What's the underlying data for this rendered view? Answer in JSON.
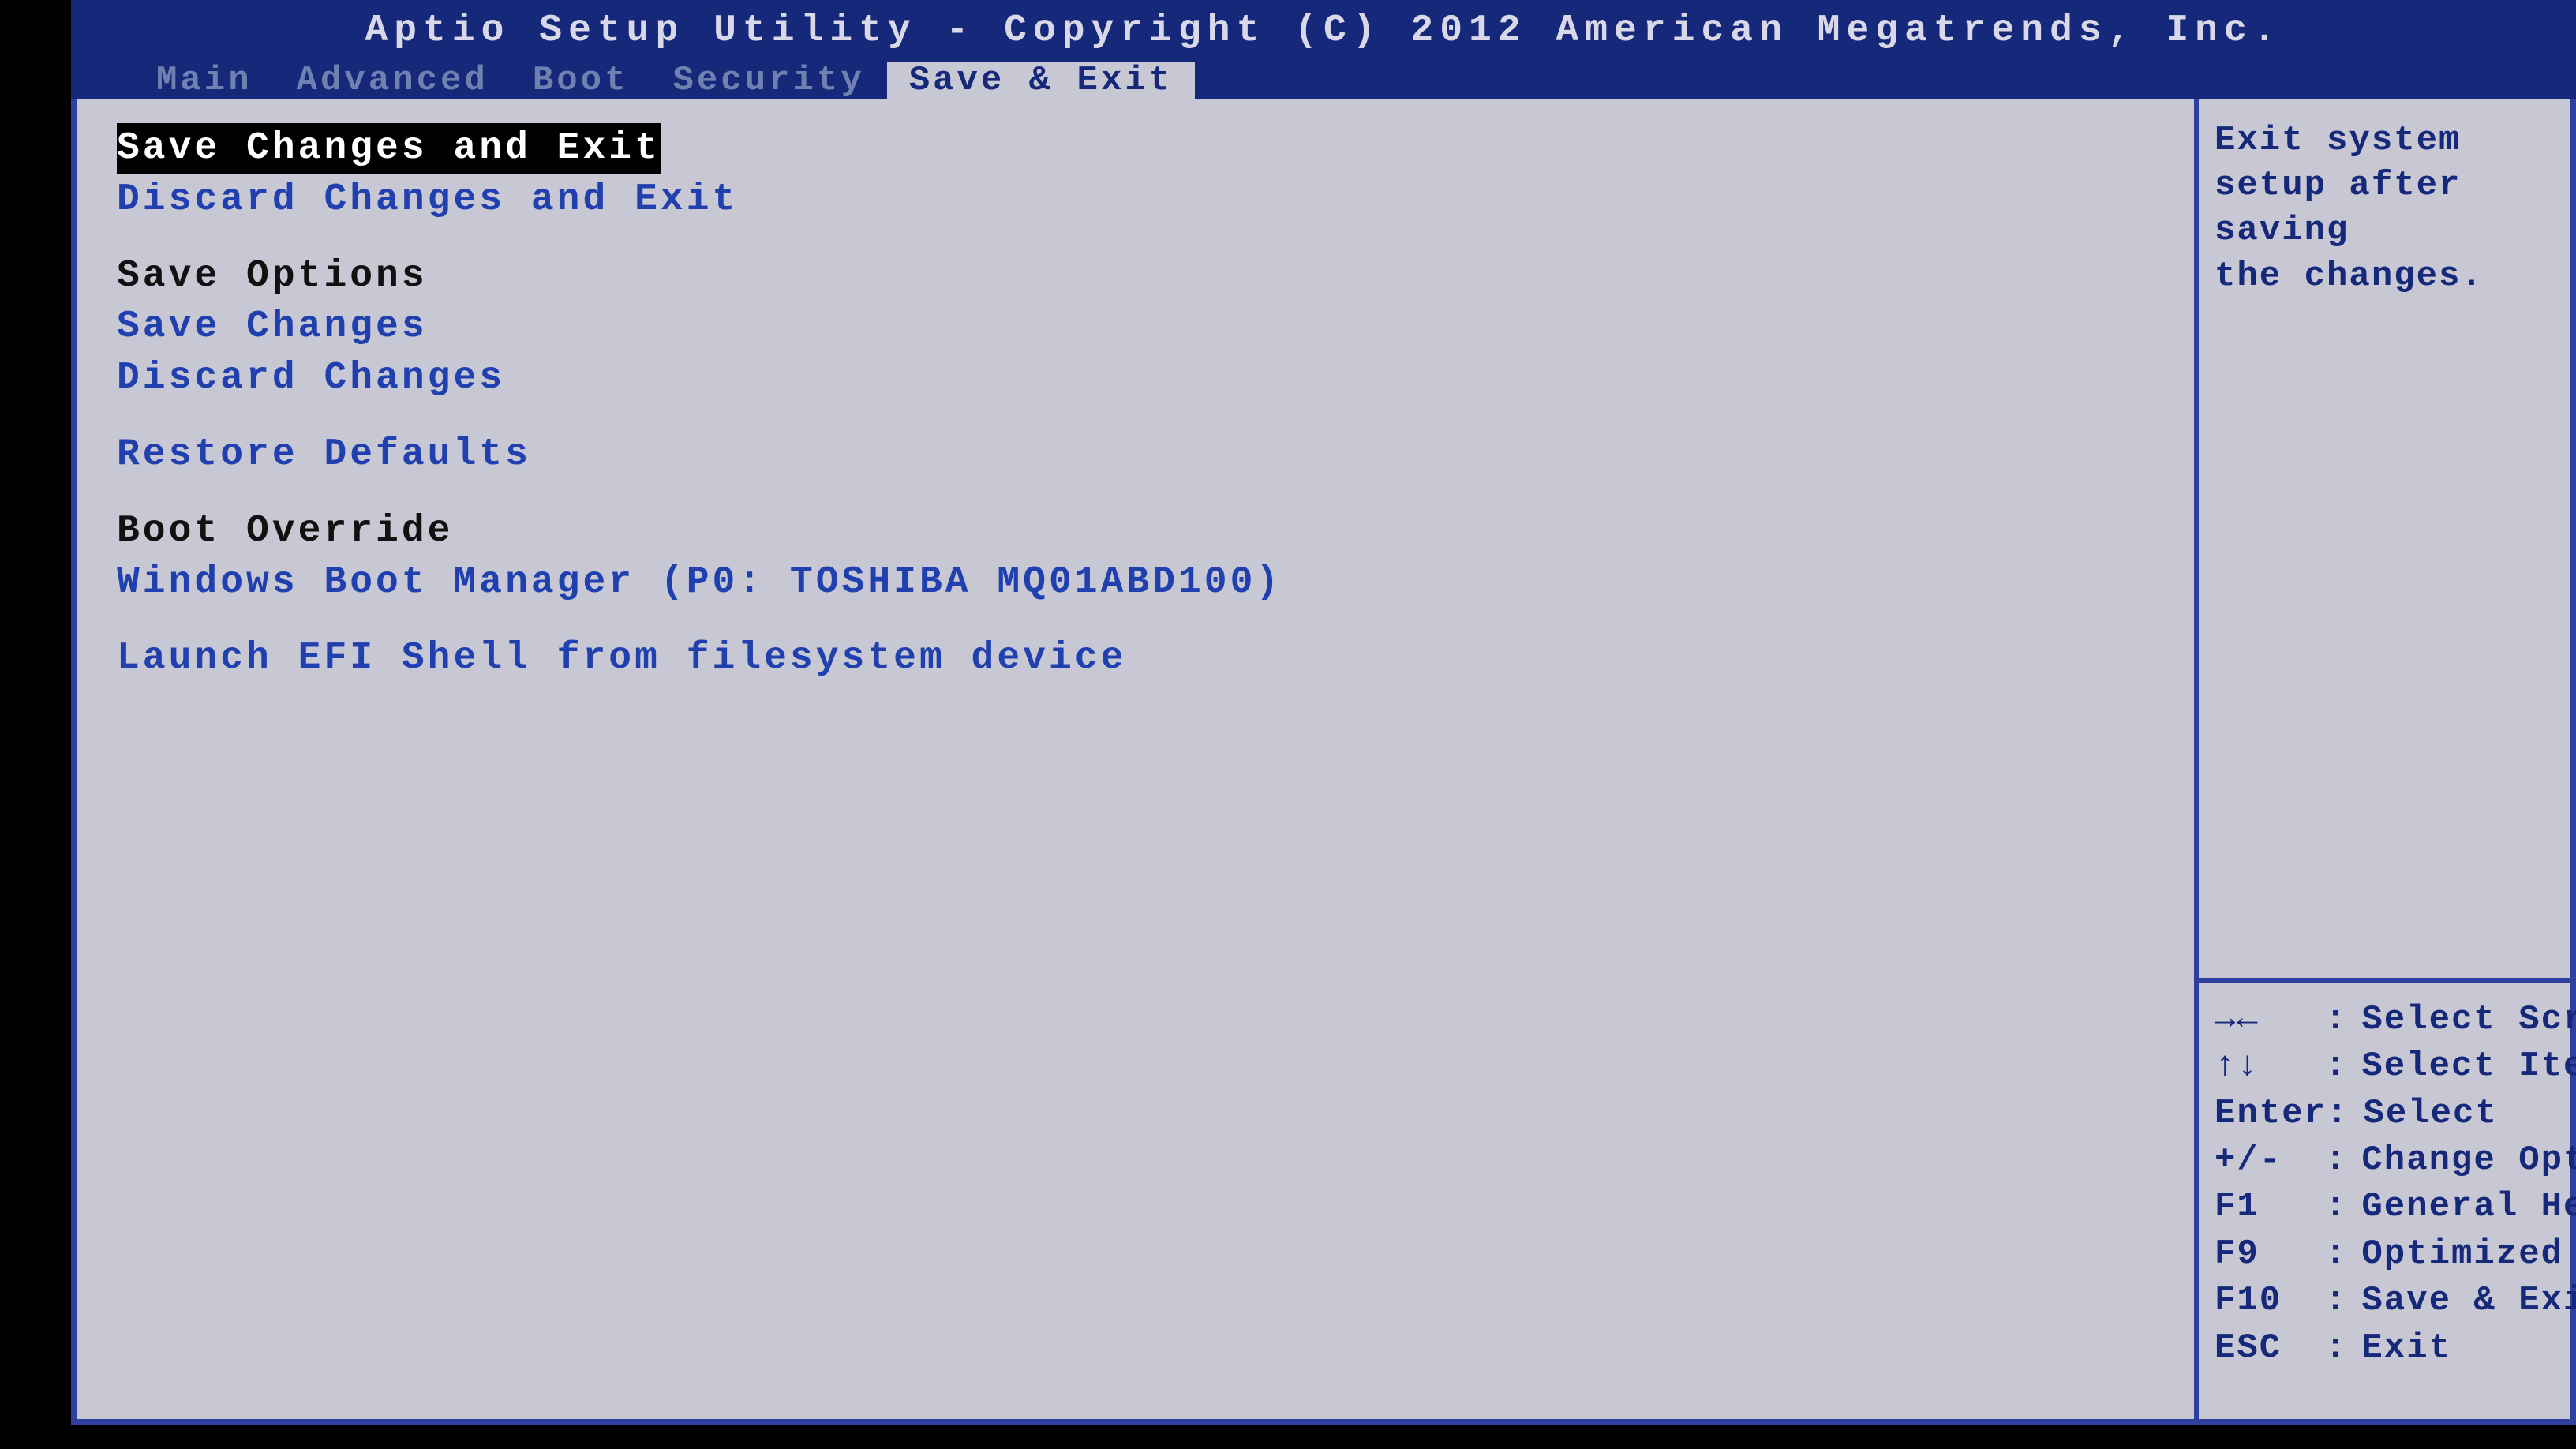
{
  "header": {
    "title": "Aptio Setup Utility - Copyright (C) 2012 American Megatrends, Inc."
  },
  "tabs": [
    {
      "label": "Main"
    },
    {
      "label": "Advanced"
    },
    {
      "label": "Boot"
    },
    {
      "label": "Security"
    },
    {
      "label": "Save & Exit"
    }
  ],
  "menu": {
    "save_exit": "Save Changes and Exit",
    "discard_exit": "Discard Changes and Exit",
    "save_options_header": "Save Options",
    "save_changes": "Save Changes",
    "discard_changes": "Discard Changes",
    "restore_defaults": "Restore Defaults",
    "boot_override_header": "Boot Override",
    "boot_device_0": "Windows Boot Manager (P0: TOSHIBA MQ01ABD100)",
    "launch_efi": "Launch EFI Shell from filesystem device"
  },
  "help": {
    "line1": "Exit system setup after saving",
    "line2": "the changes."
  },
  "keys": [
    {
      "key": "→←",
      "desc": "Select Screen"
    },
    {
      "key": "↑↓",
      "desc": "Select Item"
    },
    {
      "key": "Enter",
      "desc": "Select"
    },
    {
      "key": "+/-",
      "desc": "Change Opt."
    },
    {
      "key": "F1",
      "desc": "General Help"
    },
    {
      "key": "F9",
      "desc": "Optimized Defaults"
    },
    {
      "key": "F10",
      "desc": "Save & Exit"
    },
    {
      "key": "ESC",
      "desc": "Exit"
    }
  ]
}
